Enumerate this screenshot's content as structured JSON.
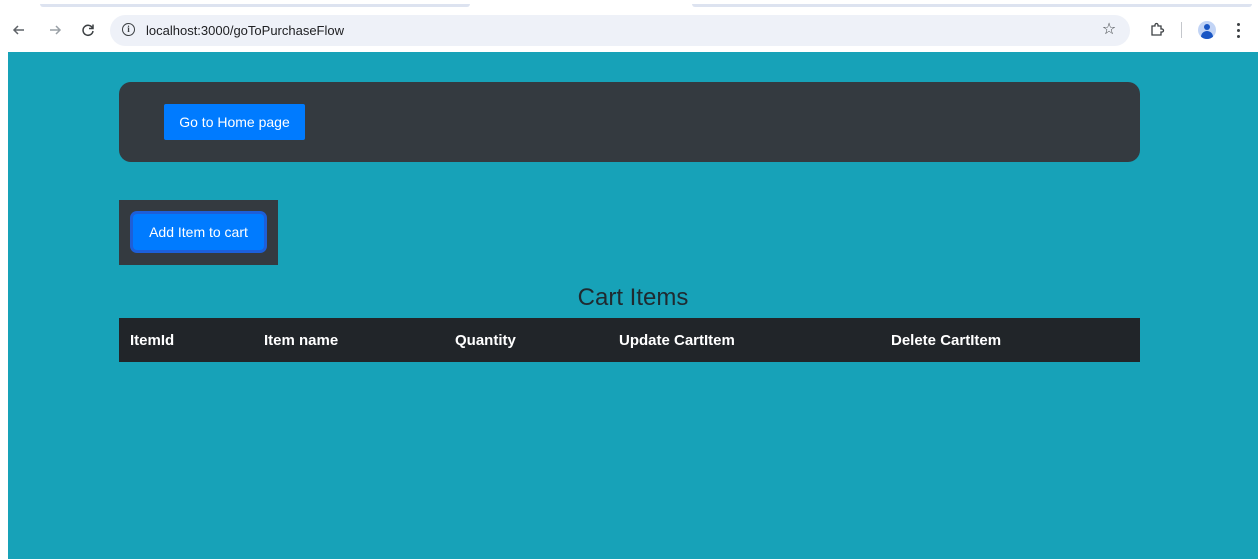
{
  "browser": {
    "url": "localhost:3000/goToPurchaseFlow",
    "icons": {
      "back": "arrow-left-icon",
      "forward": "arrow-right-icon",
      "reload": "reload-icon",
      "site_info": "info-icon",
      "bookmark": "star-icon",
      "extensions": "puzzle-icon",
      "profile": "avatar-icon",
      "menu": "kebab-menu-icon"
    }
  },
  "navbar": {
    "home_button_label": "Go to Home page"
  },
  "actions": {
    "add_item_label": "Add Item to cart"
  },
  "cart": {
    "title": "Cart Items",
    "columns": [
      "ItemId",
      "Item name",
      "Quantity",
      "Update CartItem",
      "Delete CartItem"
    ],
    "rows": []
  },
  "colors": {
    "page_background": "#17a2b8",
    "navbar_background": "#343a40",
    "button_primary": "#007bff",
    "table_header": "#212529"
  }
}
